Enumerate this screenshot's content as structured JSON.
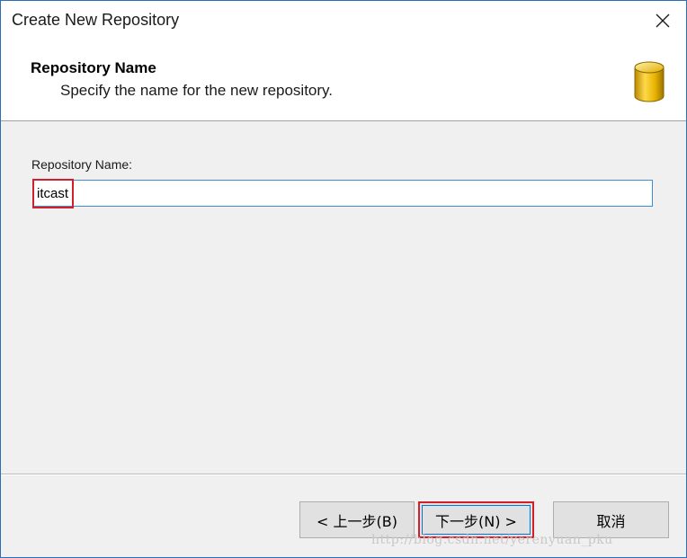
{
  "window": {
    "title": "Create New Repository"
  },
  "header": {
    "title": "Repository Name",
    "subtitle": "Specify the name for the new repository."
  },
  "form": {
    "label": "Repository Name:",
    "value": "itcast"
  },
  "buttons": {
    "back": "< 上一步(B)",
    "next": "下一步(N) >",
    "cancel": "取消"
  },
  "watermark": "http://blog.csdn.net/yerenyuan_pku",
  "colors": {
    "highlight": "#d21f2b",
    "input_border": "#3c8dd6",
    "dialog_bg": "#f0f0f0",
    "icon_gold": "#e8b400"
  },
  "icons": {
    "close": "close-icon",
    "database": "database-icon"
  }
}
